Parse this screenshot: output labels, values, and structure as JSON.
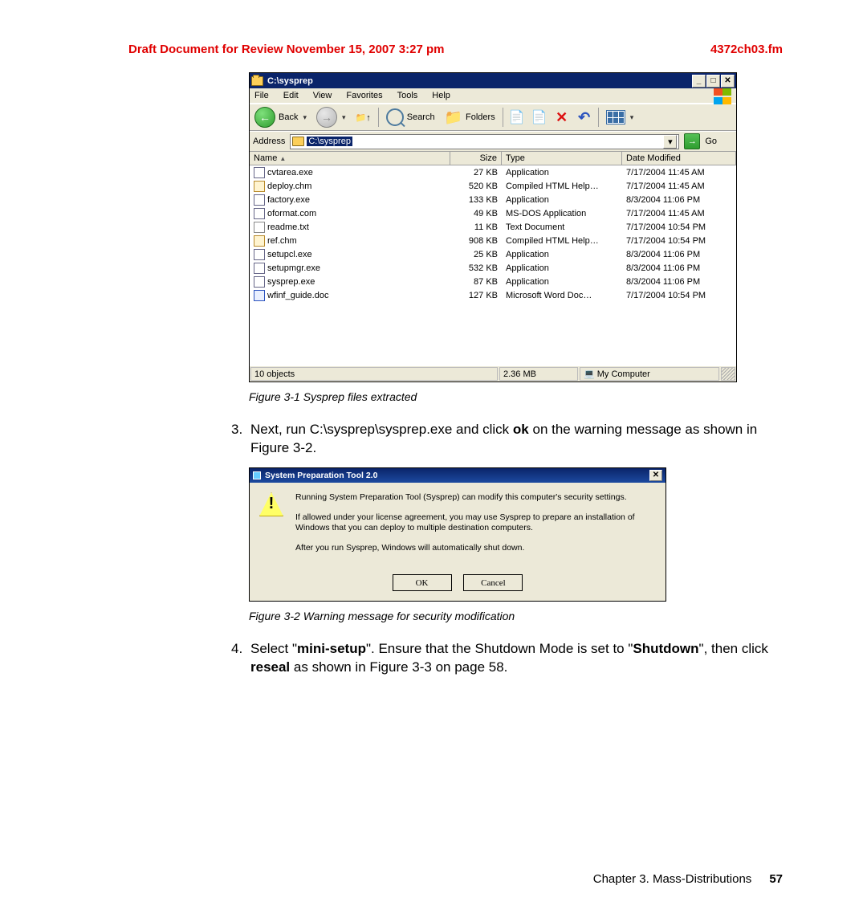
{
  "header": {
    "draft": "Draft Document for Review November 15, 2007 3:27 pm",
    "filename": "4372ch03.fm"
  },
  "explorer": {
    "title": "C:\\sysprep",
    "menu": [
      "File",
      "Edit",
      "View",
      "Favorites",
      "Tools",
      "Help"
    ],
    "toolbar": {
      "back": "Back",
      "search": "Search",
      "folders": "Folders"
    },
    "address_label": "Address",
    "address_value": "C:\\sysprep",
    "go": "Go",
    "columns": {
      "name": "Name",
      "size": "Size",
      "type": "Type",
      "modified": "Date Modified"
    },
    "files": [
      {
        "name": "cvtarea.exe",
        "size": "27 KB",
        "type": "Application",
        "modified": "7/17/2004 11:45 AM",
        "icon": "ic-exe"
      },
      {
        "name": "deploy.chm",
        "size": "520 KB",
        "type": "Compiled HTML Help…",
        "modified": "7/17/2004 11:45 AM",
        "icon": "ic-chm"
      },
      {
        "name": "factory.exe",
        "size": "133 KB",
        "type": "Application",
        "modified": "8/3/2004 11:06 PM",
        "icon": "ic-exe"
      },
      {
        "name": "oformat.com",
        "size": "49 KB",
        "type": "MS-DOS Application",
        "modified": "7/17/2004 11:45 AM",
        "icon": "ic-exe"
      },
      {
        "name": "readme.txt",
        "size": "11 KB",
        "type": "Text Document",
        "modified": "7/17/2004 10:54 PM",
        "icon": "ic-txt"
      },
      {
        "name": "ref.chm",
        "size": "908 KB",
        "type": "Compiled HTML Help…",
        "modified": "7/17/2004 10:54 PM",
        "icon": "ic-chm"
      },
      {
        "name": "setupcl.exe",
        "size": "25 KB",
        "type": "Application",
        "modified": "8/3/2004 11:06 PM",
        "icon": "ic-exe"
      },
      {
        "name": "setupmgr.exe",
        "size": "532 KB",
        "type": "Application",
        "modified": "8/3/2004 11:06 PM",
        "icon": "ic-exe"
      },
      {
        "name": "sysprep.exe",
        "size": "87 KB",
        "type": "Application",
        "modified": "8/3/2004 11:06 PM",
        "icon": "ic-exe"
      },
      {
        "name": "wfinf_guide.doc",
        "size": "127 KB",
        "type": "Microsoft Word Doc…",
        "modified": "7/17/2004 10:54 PM",
        "icon": "ic-doc"
      }
    ],
    "status": {
      "objects": "10 objects",
      "size": "2.36 MB",
      "location": "My Computer"
    }
  },
  "captions": {
    "fig1": "Figure 3-1   Sysprep files extracted",
    "fig2": "Figure 3-2   Warning message for security modification"
  },
  "step3": {
    "num": "3.",
    "pre": "Next, run C:\\sysprep\\sysprep.exe and click ",
    "bold": "ok",
    "post": " on the warning message as shown in Figure 3-2."
  },
  "dialog": {
    "title": "System Preparation Tool 2.0",
    "p1": "Running System Preparation Tool (Sysprep) can modify this computer's security settings.",
    "p2": "If allowed under your license agreement, you may use Sysprep to prepare an installation of Windows that you can deploy to multiple destination computers.",
    "p3": "After you run Sysprep, Windows will automatically shut down.",
    "ok": "OK",
    "cancel": "Cancel"
  },
  "step4": {
    "num": "4.",
    "t1": "Select \"",
    "b1": "mini-setup",
    "t2": "\". Ensure that the Shutdown Mode is set to \"",
    "b2": "Shutdown",
    "t3": "\", then click ",
    "b3": "reseal",
    "t4": " as shown in Figure 3-3 on page 58."
  },
  "footer": {
    "chapter": "Chapter 3. Mass-Distributions",
    "page": "57"
  }
}
